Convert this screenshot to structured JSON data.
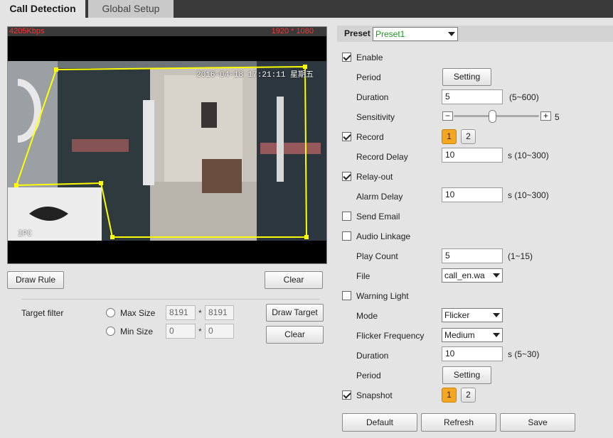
{
  "tabs": {
    "active": "Call Detection",
    "inactive": "Global Setup"
  },
  "video": {
    "bitrate": "4205Kbps",
    "resolution": "1920 * 1080",
    "osd_time": "2016-04-18 17:21:11 星期五",
    "osd_name": "IPC"
  },
  "left": {
    "draw_rule": "Draw Rule",
    "clear_rule": "Clear",
    "target_filter": "Target filter",
    "max_size_label": "Max Size",
    "max_w": "8191",
    "max_h": "8191",
    "min_size_label": "Min Size",
    "min_w": "0",
    "min_h": "0",
    "star": "*",
    "draw_target": "Draw Target",
    "clear_target": "Clear"
  },
  "right": {
    "preset_label": "Preset",
    "preset_value": "Preset1",
    "enable": "Enable",
    "period": "Period",
    "period_btn": "Setting",
    "duration": "Duration",
    "duration_val": "5",
    "duration_hint": "(5~600)",
    "sensitivity": "Sensitivity",
    "sensitivity_minus": "−",
    "sensitivity_plus": "+",
    "sensitivity_val": "5",
    "sensitivity_level": 0.5,
    "record": "Record",
    "record_ch1": "1",
    "record_ch2": "2",
    "record_delay": "Record Delay",
    "record_delay_val": "10",
    "record_delay_hint": "s (10~300)",
    "relay_out": "Relay-out",
    "alarm_delay": "Alarm Delay",
    "alarm_delay_val": "10",
    "alarm_delay_hint": "s (10~300)",
    "send_email": "Send Email",
    "audio_linkage": "Audio Linkage",
    "play_count": "Play Count",
    "play_count_val": "5",
    "play_count_hint": "(1~15)",
    "file": "File",
    "file_val": "call_en.wa",
    "warning_light": "Warning Light",
    "mode": "Mode",
    "mode_val": "Flicker",
    "flicker_freq": "Flicker Frequency",
    "flicker_freq_val": "Medium",
    "wl_duration": "Duration",
    "wl_duration_val": "10",
    "wl_duration_hint": "s (5~30)",
    "wl_period": "Period",
    "wl_period_btn": "Setting",
    "snapshot": "Snapshot",
    "snap_ch1": "1",
    "snap_ch2": "2",
    "default_btn": "Default",
    "refresh_btn": "Refresh",
    "save_btn": "Save"
  },
  "checked": {
    "enable": true,
    "record": true,
    "relay_out": true,
    "send_email": false,
    "audio_linkage": false,
    "warning_light": false,
    "snapshot": true
  },
  "colors": {
    "accent": "#f5a623",
    "rule": "#ffff00",
    "overlay_text": "#ff3030"
  }
}
